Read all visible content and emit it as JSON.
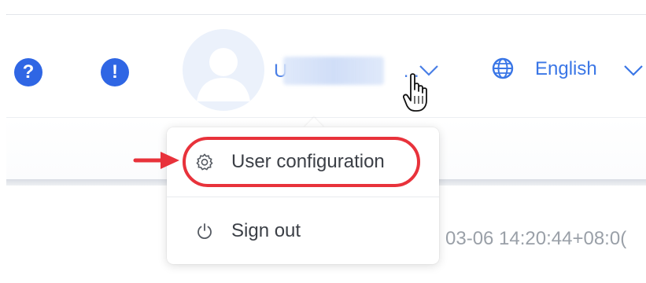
{
  "header": {
    "help_icon_glyph": "?",
    "alert_icon_glyph": "!",
    "username": "U",
    "username_ellipsis": "...",
    "language": {
      "label": "English",
      "icon": "globe-icon"
    }
  },
  "user_menu": {
    "items": [
      {
        "label": "User configuration",
        "icon": "gear-icon"
      },
      {
        "label": "Sign out",
        "icon": "power-icon"
      }
    ]
  },
  "content": {
    "timestamp": "03-06 14:20:44+08:0("
  },
  "colors": {
    "accent": "#2f66e4",
    "link": "#3a76e6",
    "annotation": "#e8323b"
  }
}
